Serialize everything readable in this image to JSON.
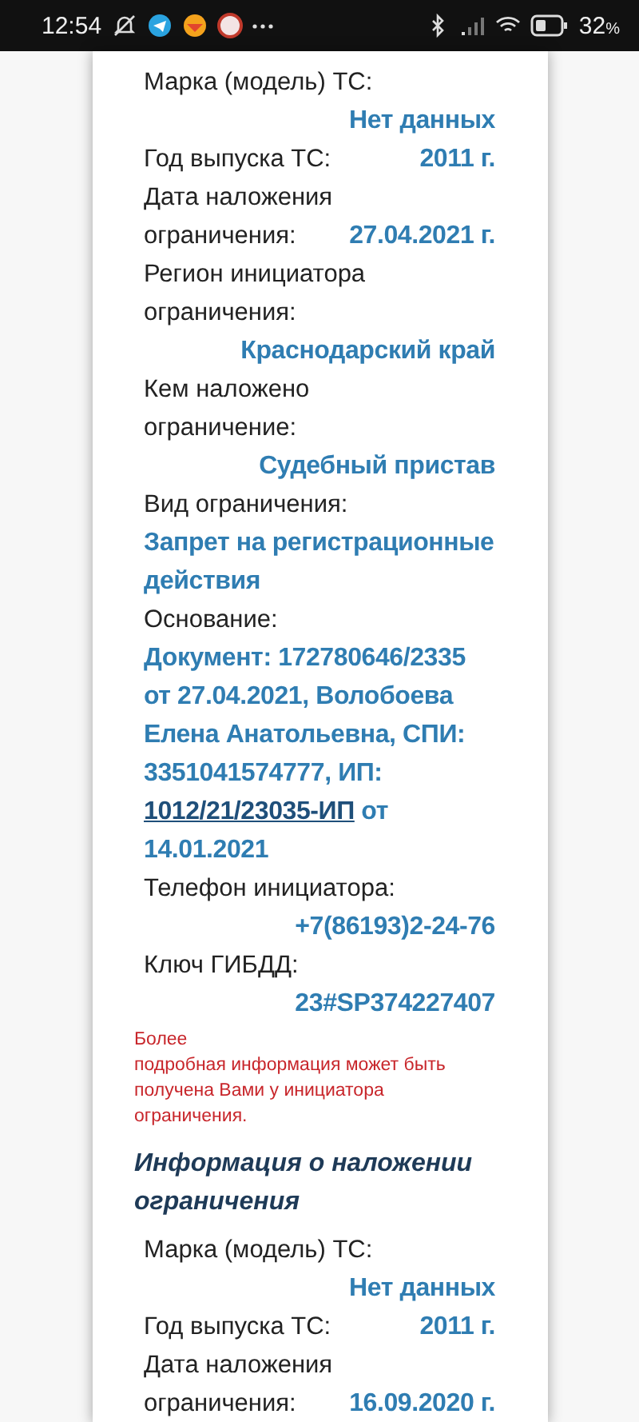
{
  "status_bar": {
    "time": "12:54",
    "battery": "32",
    "battery_unit": "%"
  },
  "sections": [
    {
      "fields": [
        {
          "label": "Марка (модель) ТС:",
          "kind": "below",
          "value": [
            {
              "kind": "text",
              "text": "Нет данных"
            }
          ]
        },
        {
          "label": "Год выпуска ТС:",
          "kind": "inline",
          "value": [
            {
              "kind": "text",
              "text": "2011 г."
            }
          ]
        },
        {
          "label": "Дата наложения ограничения:",
          "kind": "inline",
          "value": [
            {
              "kind": "text",
              "text": "27.04.2021 г."
            }
          ]
        },
        {
          "label": "Регион инициатора ограничения:",
          "kind": "below",
          "value": [
            {
              "kind": "text",
              "text": "Краснодарский край"
            }
          ]
        },
        {
          "label": "Кем наложено ограничение:",
          "kind": "below",
          "value": [
            {
              "kind": "text",
              "text": "Судебный пристав"
            }
          ]
        },
        {
          "label": "Вид ограничения:",
          "kind": "block",
          "value": [
            {
              "kind": "text",
              "text": "Запрет на регистрационные действия"
            }
          ]
        },
        {
          "label": "Основание:",
          "kind": "block",
          "value": [
            {
              "kind": "text",
              "text": "Документ: 172780646/2335 от 27.04.2021, Волобоева Елена Анатольевна, СПИ: 3351041574777, ИП: "
            },
            {
              "kind": "link",
              "text": "1012/21/23035-ИП"
            },
            {
              "kind": "text",
              "text": " от 14.01.2021"
            }
          ]
        },
        {
          "label": "Телефон инициатора:",
          "kind": "below",
          "value": [
            {
              "kind": "text",
              "text": "+7(86193)2-24-76"
            }
          ]
        },
        {
          "label": "Ключ ГИБДД:",
          "kind": "below",
          "value": [
            {
              "kind": "text",
              "text": "23#SP374227407"
            }
          ]
        }
      ],
      "note": [
        "Более",
        "подробная информация может быть получена Вами у инициатора ограничения."
      ]
    },
    {
      "heading": "Информация о наложении ограничения",
      "fields": [
        {
          "label": "Марка (модель) ТС:",
          "kind": "below",
          "value": [
            {
              "kind": "text",
              "text": "Нет данных"
            }
          ]
        },
        {
          "label": "Год выпуска ТС:",
          "kind": "inline",
          "value": [
            {
              "kind": "text",
              "text": "2011 г."
            }
          ]
        },
        {
          "label": "Дата наложения ограничения:",
          "kind": "inline",
          "value": [
            {
              "kind": "text",
              "text": "16.09.2020 г."
            }
          ]
        }
      ]
    }
  ]
}
